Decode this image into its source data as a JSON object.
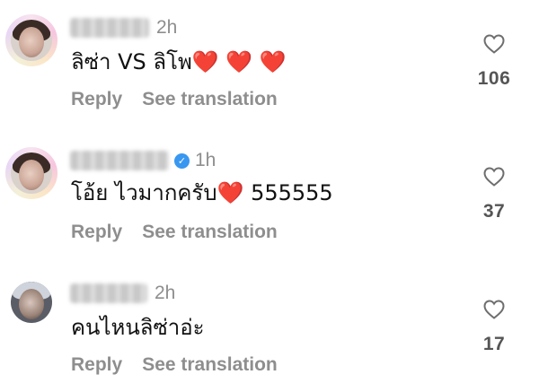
{
  "comments": [
    {
      "username": "ah_mara",
      "time": "2h",
      "text": "ลิซ่า VS ลิโพ",
      "emoji": "❤️ ❤️ ❤️",
      "reply_label": "Reply",
      "translate_label": "See translation",
      "likes": "106",
      "verified": false
    },
    {
      "username": "baanakanai",
      "time": "1h",
      "text": "โอ้ย ไวมากครับ",
      "emoji": "❤️",
      "text_after": " 555555",
      "reply_label": "Reply",
      "translate_label": "See translation",
      "likes": "37",
      "verified": true
    },
    {
      "username": "aoyyllka",
      "time": "2h",
      "text": "คนไหนลิซ่าอ่ะ",
      "reply_label": "Reply",
      "translate_label": "See translation",
      "likes": "17",
      "verified": false
    }
  ],
  "colors": {
    "secondary_text": "#8e8e8e",
    "heart": "#e0242a",
    "verified": "#3897f0"
  },
  "icons": {
    "like": "heart-outline-icon",
    "verified": "verified-badge-icon"
  }
}
